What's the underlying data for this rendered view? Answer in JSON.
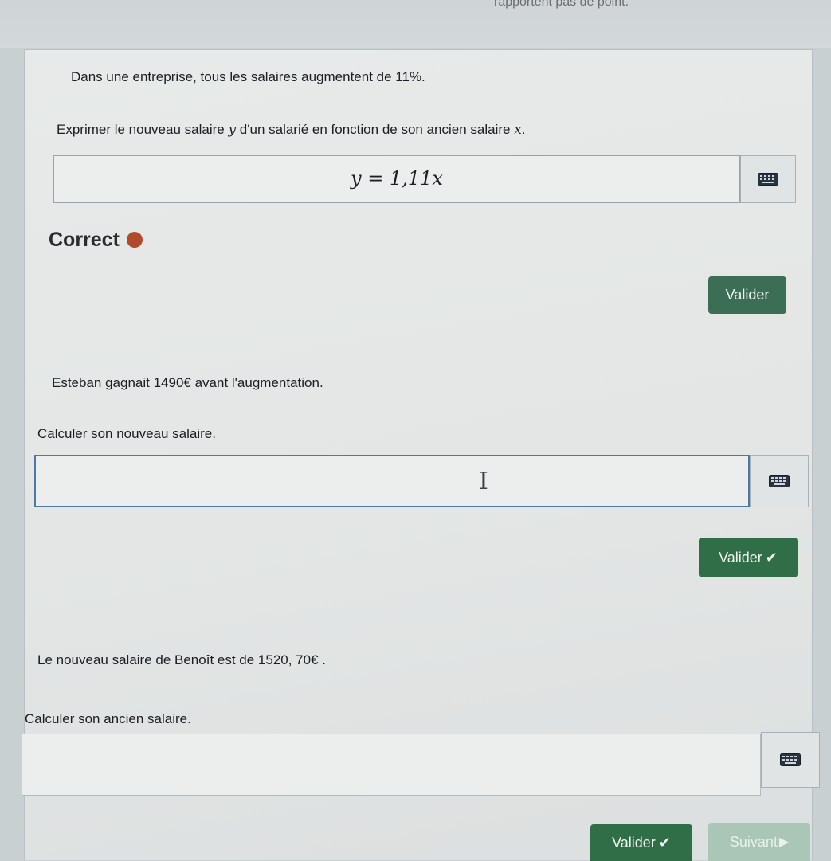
{
  "header": {
    "fragment": "rapportent pas de point."
  },
  "question1": {
    "statement": "Dans une entreprise, tous les salaires augmentent de 11%.",
    "prompt_before": "Exprimer le nouveau salaire ",
    "var_y": "y",
    "prompt_middle": " d'un salarié en fonction de son ancien salaire ",
    "var_x": "x",
    "prompt_end": ".",
    "answer": "y = 1,11x",
    "status": "Correct",
    "status_color": "#b04a2a",
    "validate_label": "Valider"
  },
  "question2": {
    "statement": "Esteban gagnait 1490€ avant l'augmentation.",
    "prompt": "Calculer son nouveau salaire.",
    "answer": "",
    "validate_label": "Valider"
  },
  "question3": {
    "statement": "Le nouveau salaire de Benoît est de 1520, 70€ .",
    "prompt": "Calculer son ancien salaire.",
    "answer": "",
    "validate_label": "Valider"
  },
  "footer": {
    "next_label": "Suivant"
  },
  "colors": {
    "button_dark": "#3b6e54",
    "button_green": "#2f6e46",
    "button_disabled": "#a9c6b6",
    "focus_border": "#4c79a8"
  },
  "icons": {
    "keyboard": "keyboard-icon",
    "check": "check-icon",
    "next": "play-arrow-icon",
    "status": "status-dot-icon",
    "cursor": "text-cursor-icon"
  }
}
